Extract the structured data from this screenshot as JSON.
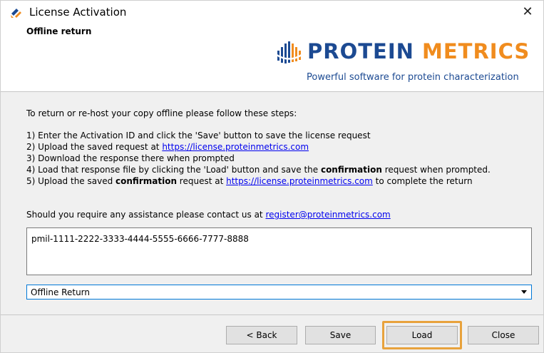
{
  "window": {
    "title": "License Activation",
    "close_glyph": "✕",
    "icon": "app-logo-icon"
  },
  "header": {
    "section_title": "Offline return",
    "logo": {
      "name_part1": "PROTEIN ",
      "name_part2": "METRICS",
      "tagline": "Powerful software for protein characterization",
      "colors": {
        "primary": "#1c4a92",
        "accent": "#f08c1e"
      }
    }
  },
  "instructions": {
    "intro": "To return or re-host your copy offline please follow these steps:",
    "step1": "1) Enter the Activation ID and click the 'Save' button to save the license request",
    "step2_prefix": "2) Upload the saved request at ",
    "step2_link": "https://license.proteinmetrics.com",
    "step3": "3) Download the response there when prompted",
    "step4_prefix": "4) Load that response file by clicking the 'Load' button and save the ",
    "step4_bold": "confirmation",
    "step4_suffix": " request when prompted.",
    "step5_prefix": "5) Upload the saved ",
    "step5_bold": "confirmation",
    "step5_mid": " request at ",
    "step5_link": "https://license.proteinmetrics.com",
    "step5_suffix": " to complete the return",
    "contact_prefix": "Should you require any assistance please contact us at ",
    "contact_link": "register@proteinmetrics.com"
  },
  "activation_id": {
    "value": "pmil-1111-2222-3333-4444-5555-6666-7777-8888"
  },
  "mode_select": {
    "selected": "Offline Return"
  },
  "buttons": {
    "back": "< Back",
    "save": "Save",
    "load": "Load",
    "close": "Close",
    "highlight_color": "#e8a23c"
  }
}
